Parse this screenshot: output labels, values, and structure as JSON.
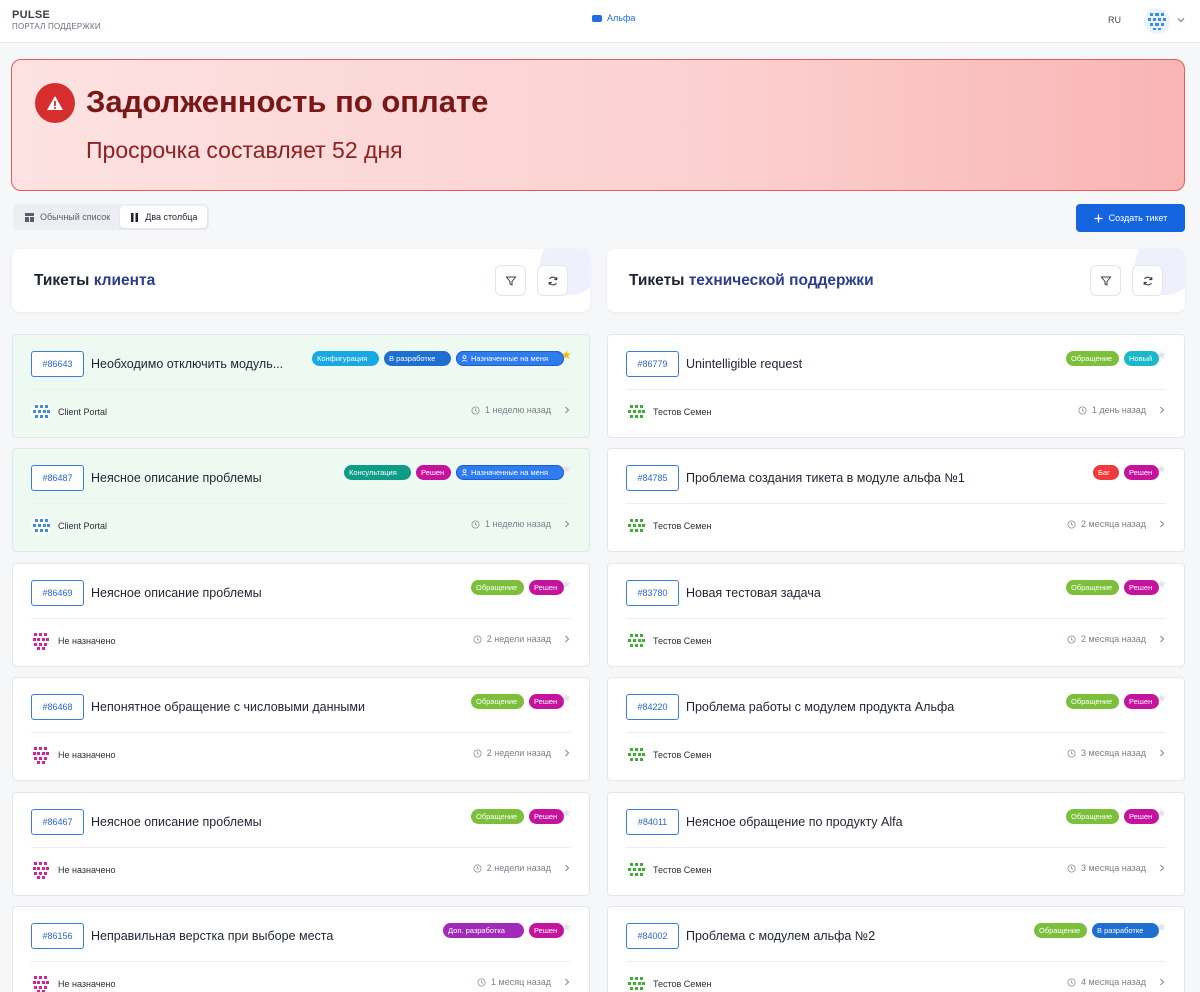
{
  "header": {
    "brand_title": "PULSE",
    "brand_subtitle": "ПОРТАЛ ПОДДЕРЖКИ",
    "org_name": "Альфа",
    "language": "RU"
  },
  "alert": {
    "title": "Задолженность по оплате",
    "subtitle": "Просрочка составляет 52 дня"
  },
  "view_toggle": {
    "list_label": "Обычный список",
    "two_col_label": "Два столбца",
    "active": "two_col"
  },
  "create_button": {
    "label": "Создать тикет"
  },
  "colors": {
    "primary": "#1565e0",
    "alert_border": "#e55a5a",
    "star_active": "#f5b800",
    "star_inactive": "#e1e3e8"
  },
  "columns": [
    {
      "title_plain": "Тикеты ",
      "title_accent": "клиента",
      "tickets": [
        {
          "id": "#86643",
          "title": "Необходимо отключить модуль...",
          "highlight": true,
          "starred": true,
          "badges": [
            {
              "label": "Конфигурация",
              "color": "#17a9e3"
            },
            {
              "label": "В разработке",
              "color": "#1f6fd1"
            },
            {
              "label": "Назначенные на меня",
              "color": "#2f7cf0",
              "icon": "user-icon",
              "outline": true
            }
          ],
          "assignee": "Client Portal",
          "avatar": "client",
          "time": "1 неделю назад"
        },
        {
          "id": "#86487",
          "title": "Неясное описание проблемы",
          "highlight": true,
          "starred": false,
          "badges": [
            {
              "label": "Консультация",
              "color": "#0f9c86"
            },
            {
              "label": "Решен",
              "color": "#c4149e"
            },
            {
              "label": "Назначенные на меня",
              "color": "#2f7cf0",
              "icon": "user-icon",
              "outline": true
            }
          ],
          "assignee": "Client Portal",
          "avatar": "client",
          "time": "1 неделю назад"
        },
        {
          "id": "#86469",
          "title": "Неясное описание проблемы",
          "highlight": false,
          "starred": false,
          "badges": [
            {
              "label": "Обращение",
              "color": "#7cbf3a"
            },
            {
              "label": "Решен",
              "color": "#c4149e"
            }
          ],
          "assignee": "Не назначено",
          "avatar": "none",
          "time": "2 недели назад"
        },
        {
          "id": "#86468",
          "title": "Непонятное обращение с числовыми данными",
          "highlight": false,
          "starred": false,
          "badges": [
            {
              "label": "Обращение",
              "color": "#7cbf3a"
            },
            {
              "label": "Решен",
              "color": "#c4149e"
            }
          ],
          "assignee": "Не назначено",
          "avatar": "none",
          "time": "2 недели назад"
        },
        {
          "id": "#86467",
          "title": "Неясное описание проблемы",
          "highlight": false,
          "starred": false,
          "badges": [
            {
              "label": "Обращение",
              "color": "#7cbf3a"
            },
            {
              "label": "Решен",
              "color": "#c4149e"
            }
          ],
          "assignee": "Не назначено",
          "avatar": "none",
          "time": "2 недели назад"
        },
        {
          "id": "#86156",
          "title": "Неправильная верстка при выборе места",
          "highlight": false,
          "starred": false,
          "badges": [
            {
              "label": "Доп. разработка",
              "color": "#a12bb8"
            },
            {
              "label": "Решен",
              "color": "#c4149e"
            }
          ],
          "assignee": "Не назначено",
          "avatar": "none",
          "time": "1 месяц назад"
        }
      ]
    },
    {
      "title_plain": "Тикеты ",
      "title_accent": "технической поддержки",
      "tickets": [
        {
          "id": "#86779",
          "title": "Unintelligible request",
          "highlight": false,
          "starred": false,
          "badges": [
            {
              "label": "Обращение",
              "color": "#7cbf3a"
            },
            {
              "label": "Новый",
              "color": "#1ab8c9"
            }
          ],
          "assignee": "Тестов Семен",
          "avatar": "green",
          "time": "1 день назад"
        },
        {
          "id": "#84785",
          "title": "Проблема создания тикета в модуле альфа №1",
          "highlight": false,
          "starred": false,
          "badges": [
            {
              "label": "Баг",
              "color": "#ef3b3b"
            },
            {
              "label": "Решен",
              "color": "#c4149e"
            }
          ],
          "assignee": "Тестов Семен",
          "avatar": "green",
          "time": "2 месяца назад"
        },
        {
          "id": "#83780",
          "title": "Новая тестовая задача",
          "highlight": false,
          "starred": false,
          "badges": [
            {
              "label": "Обращение",
              "color": "#7cbf3a"
            },
            {
              "label": "Решен",
              "color": "#c4149e"
            }
          ],
          "assignee": "Тестов Семен",
          "avatar": "green",
          "time": "2 месяца назад"
        },
        {
          "id": "#84220",
          "title": "Проблема работы с модулем продукта Альфа",
          "highlight": false,
          "starred": false,
          "badges": [
            {
              "label": "Обращение",
              "color": "#7cbf3a"
            },
            {
              "label": "Решен",
              "color": "#c4149e"
            }
          ],
          "assignee": "Тестов Семен",
          "avatar": "green",
          "time": "3 месяца назад"
        },
        {
          "id": "#84011",
          "title": "Неясное обращение по продукту Alfa",
          "highlight": false,
          "starred": false,
          "badges": [
            {
              "label": "Обращение",
              "color": "#7cbf3a"
            },
            {
              "label": "Решен",
              "color": "#c4149e"
            }
          ],
          "assignee": "Тестов Семен",
          "avatar": "green",
          "time": "3 месяца назад"
        },
        {
          "id": "#84002",
          "title": "Проблема с модулем альфа №2",
          "highlight": false,
          "starred": false,
          "badges": [
            {
              "label": "Обращение",
              "color": "#7cbf3a"
            },
            {
              "label": "В разработке",
              "color": "#1f6fd1"
            }
          ],
          "assignee": "Тестов Семен",
          "avatar": "green",
          "time": "4 месяца назад"
        }
      ]
    }
  ]
}
